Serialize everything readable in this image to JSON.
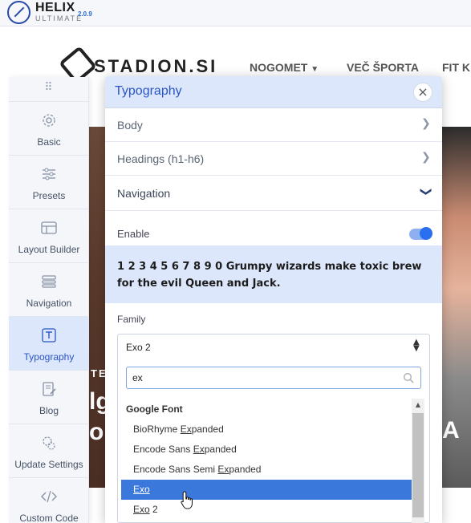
{
  "helix": {
    "title": "HELIX",
    "subtitle": "ULTIMATE",
    "version": "2.0.9"
  },
  "site": {
    "logo_text": "STADION.SI",
    "nav": [
      "NOGOMET",
      "VEČ ŠPORTA",
      "FIT K"
    ],
    "hero_texts": [
      "TE",
      "lg",
      "o",
      "A"
    ]
  },
  "sidebar": {
    "handle": "⠿",
    "items": [
      {
        "label": "Basic",
        "icon": "gear-icon"
      },
      {
        "label": "Presets",
        "icon": "sliders-icon"
      },
      {
        "label": "Layout Builder",
        "icon": "layout-icon"
      },
      {
        "label": "Navigation",
        "icon": "menu-list-icon"
      },
      {
        "label": "Typography",
        "icon": "text-icon",
        "active": true
      },
      {
        "label": "Blog",
        "icon": "edit-document-icon"
      },
      {
        "label": "Update Settings",
        "icon": "gears-icon"
      },
      {
        "label": "Custom Code",
        "icon": "code-icon"
      }
    ]
  },
  "panel": {
    "title": "Typography",
    "close": "×",
    "sections": [
      {
        "label": "Body",
        "state": "collapsed"
      },
      {
        "label": "Headings (h1-h6)",
        "state": "collapsed"
      },
      {
        "label": "Navigation",
        "state": "expanded"
      }
    ],
    "navigation": {
      "enable_label": "Enable",
      "enabled": true,
      "preview_text": "1 2 3 4 5 6 7 8 9 0 Grumpy wizards make toxic brew for the evil Queen and Jack.",
      "family_label": "Family",
      "family_value": "Exo 2",
      "search_value": "ex",
      "dropdown": {
        "group": "Google Font",
        "options": [
          {
            "pre": "BioRhyme ",
            "match": "Ex",
            "post": "panded"
          },
          {
            "pre": "Encode Sans ",
            "match": "Ex",
            "post": "panded"
          },
          {
            "pre": "Encode Sans Semi ",
            "match": "Ex",
            "post": "panded"
          },
          {
            "pre": "",
            "match": "Exo",
            "post": "",
            "selected": true
          },
          {
            "pre": "",
            "match": "Exo",
            "post": " 2"
          }
        ]
      }
    }
  },
  "colors": {
    "accent": "#2a55c4",
    "selected": "#3b78db",
    "panel_header": "#dde7fb"
  }
}
